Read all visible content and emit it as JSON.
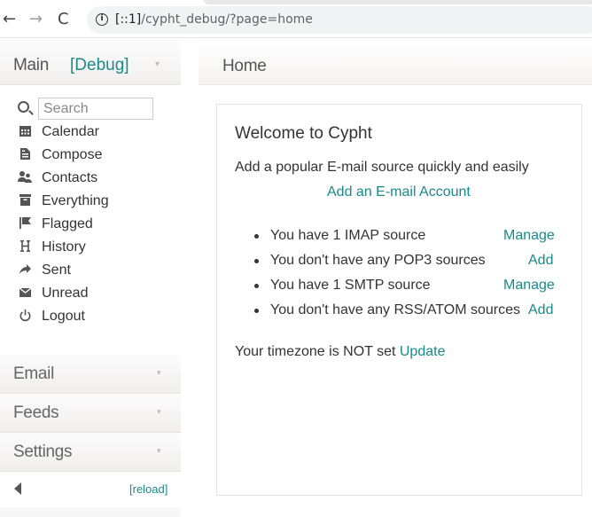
{
  "browser": {
    "back_icon": "←",
    "forward_icon": "→",
    "reload_icon": "C",
    "info_icon": "i",
    "url_host": "[::1]",
    "url_path": "/cypht_debug/?page=home"
  },
  "sidebar": {
    "main_title": "Main",
    "debug_label": "[Debug]",
    "search_placeholder": "Search",
    "items": [
      {
        "label": "Calendar",
        "icon": "calendar-icon"
      },
      {
        "label": "Compose",
        "icon": "compose-icon"
      },
      {
        "label": "Contacts",
        "icon": "contacts-icon"
      },
      {
        "label": "Everything",
        "icon": "everything-icon"
      },
      {
        "label": "Flagged",
        "icon": "flag-icon"
      },
      {
        "label": "History",
        "icon": "history-icon"
      },
      {
        "label": "Sent",
        "icon": "sent-icon"
      },
      {
        "label": "Unread",
        "icon": "unread-icon"
      },
      {
        "label": "Logout",
        "icon": "logout-icon"
      }
    ],
    "sections": [
      "Email",
      "Feeds",
      "Settings"
    ],
    "reload_label": "[reload]"
  },
  "main": {
    "page_title": "Home",
    "welcome": "Welcome to Cypht",
    "quick_text": "Add a popular E-mail source quickly and easily",
    "add_account": "Add an E-mail Account",
    "sources": [
      {
        "text": "You have 1 IMAP source",
        "action": "Manage"
      },
      {
        "text": "You don't have any POP3 sources",
        "action": "Add"
      },
      {
        "text": "You have 1 SMTP source",
        "action": "Manage"
      },
      {
        "text": "You don't have any RSS/ATOM sources",
        "action": "Add"
      }
    ],
    "timezone_text": "Your timezone is NOT set",
    "timezone_link": "Update"
  },
  "colors": {
    "accent": "#1a8a8a",
    "text": "#333333",
    "sidebar_bg": "#f7f7f7"
  }
}
